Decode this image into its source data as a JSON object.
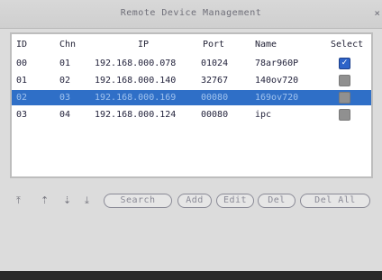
{
  "window": {
    "title": "Remote Device Management",
    "close": "×"
  },
  "table": {
    "headers": {
      "id": "ID",
      "chn": "Chn",
      "ip": "IP",
      "port": "Port",
      "name": "Name",
      "select": "Select"
    },
    "rows": [
      {
        "id": "00",
        "chn": "01",
        "ip": "192.168.000.078",
        "port": "01024",
        "name": "78ar960P",
        "selected": true
      },
      {
        "id": "01",
        "chn": "02",
        "ip": "192.168.000.140",
        "port": "32767",
        "name": "140ov720",
        "selected": false
      },
      {
        "id": "02",
        "chn": "03",
        "ip": "192.168.000.169",
        "port": "00080",
        "name": "169ov720",
        "selected": false
      },
      {
        "id": "03",
        "chn": "04",
        "ip": "192.168.000.124",
        "port": "00080",
        "name": "ipc",
        "selected": false
      }
    ],
    "highlighted_row": 2
  },
  "toolbar": {
    "first_icon": "first-page-icon",
    "prev_icon": "previous-page-icon",
    "next_icon": "next-page-icon",
    "last_icon": "last-page-icon",
    "search": "Search",
    "add": "Add",
    "edit": "Edit",
    "del": "Del",
    "del_all": "Del All"
  },
  "colors": {
    "highlight": "#2f6fc7",
    "check_on": "#2d63c8",
    "check_off": "#909090"
  }
}
